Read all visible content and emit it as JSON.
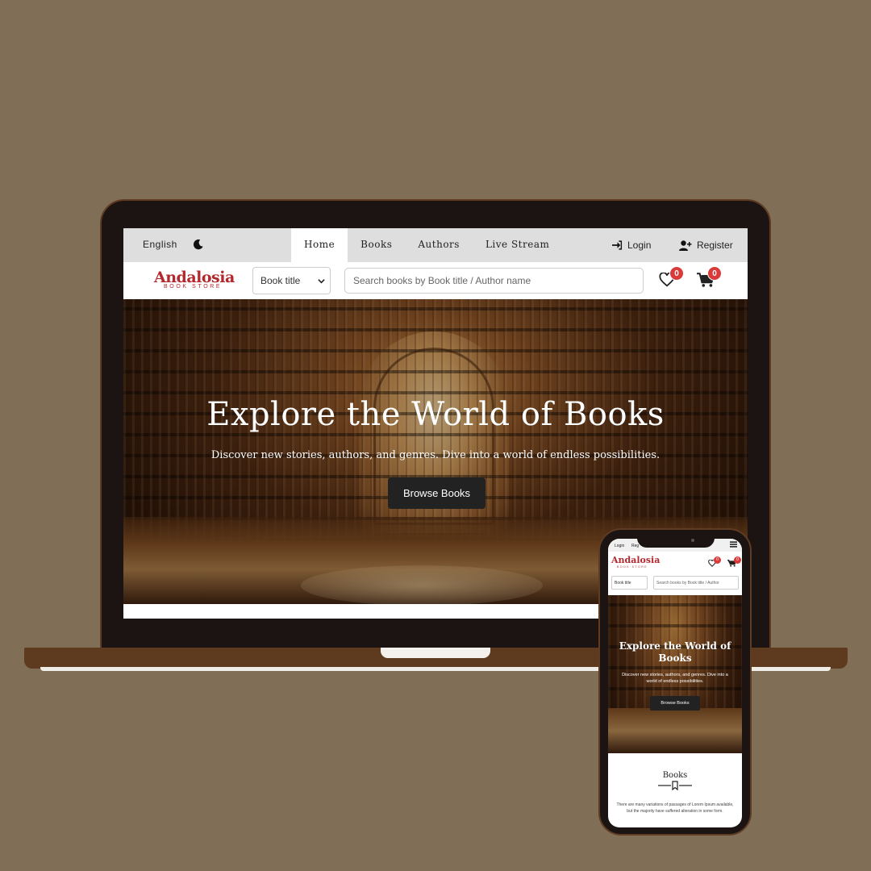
{
  "colors": {
    "background": "#806f56",
    "frame": "#1c1412",
    "frame_border": "#5e3b22",
    "brand_red": "#b3282d",
    "badge_red": "#d93a3a",
    "button_dark": "#222222"
  },
  "desktop": {
    "topbar": {
      "language": "English",
      "theme_icon": "moon-icon",
      "nav": [
        {
          "label": "Home",
          "active": true
        },
        {
          "label": "Books",
          "active": false
        },
        {
          "label": "Authors",
          "active": false
        },
        {
          "label": "Live Stream",
          "active": false
        }
      ],
      "login_label": "Login",
      "register_label": "Register"
    },
    "header": {
      "logo_main": "Andalosia",
      "logo_sub": "BOOK STORE",
      "select_value": "Book title",
      "search_placeholder": "Search books by Book title / Author name",
      "wishlist_count": "0",
      "cart_count": "0"
    },
    "hero": {
      "title": "Explore the World of Books",
      "subtitle": "Discover new stories, authors, and genres. Dive into a world of endless possibilities.",
      "button": "Browse Books"
    }
  },
  "mobile": {
    "topbar": {
      "login_label": "Login",
      "register_label": "Reg"
    },
    "header": {
      "logo_main": "Andalosia",
      "logo_sub": "BOOK STORE",
      "select_value": "Book title",
      "search_placeholder": "Search books by Book title / Author",
      "wishlist_count": "0",
      "cart_count": "0"
    },
    "hero": {
      "title": "Explore the World of Books",
      "subtitle": "Discover new stories, authors, and genres. Dive into a world of endless possibilities.",
      "button": "Browse Books"
    },
    "books_section": {
      "title": "Books",
      "text": "There are many variations of passages of Lorem Ipsum available, but the majority have suffered alteration in some form."
    }
  }
}
